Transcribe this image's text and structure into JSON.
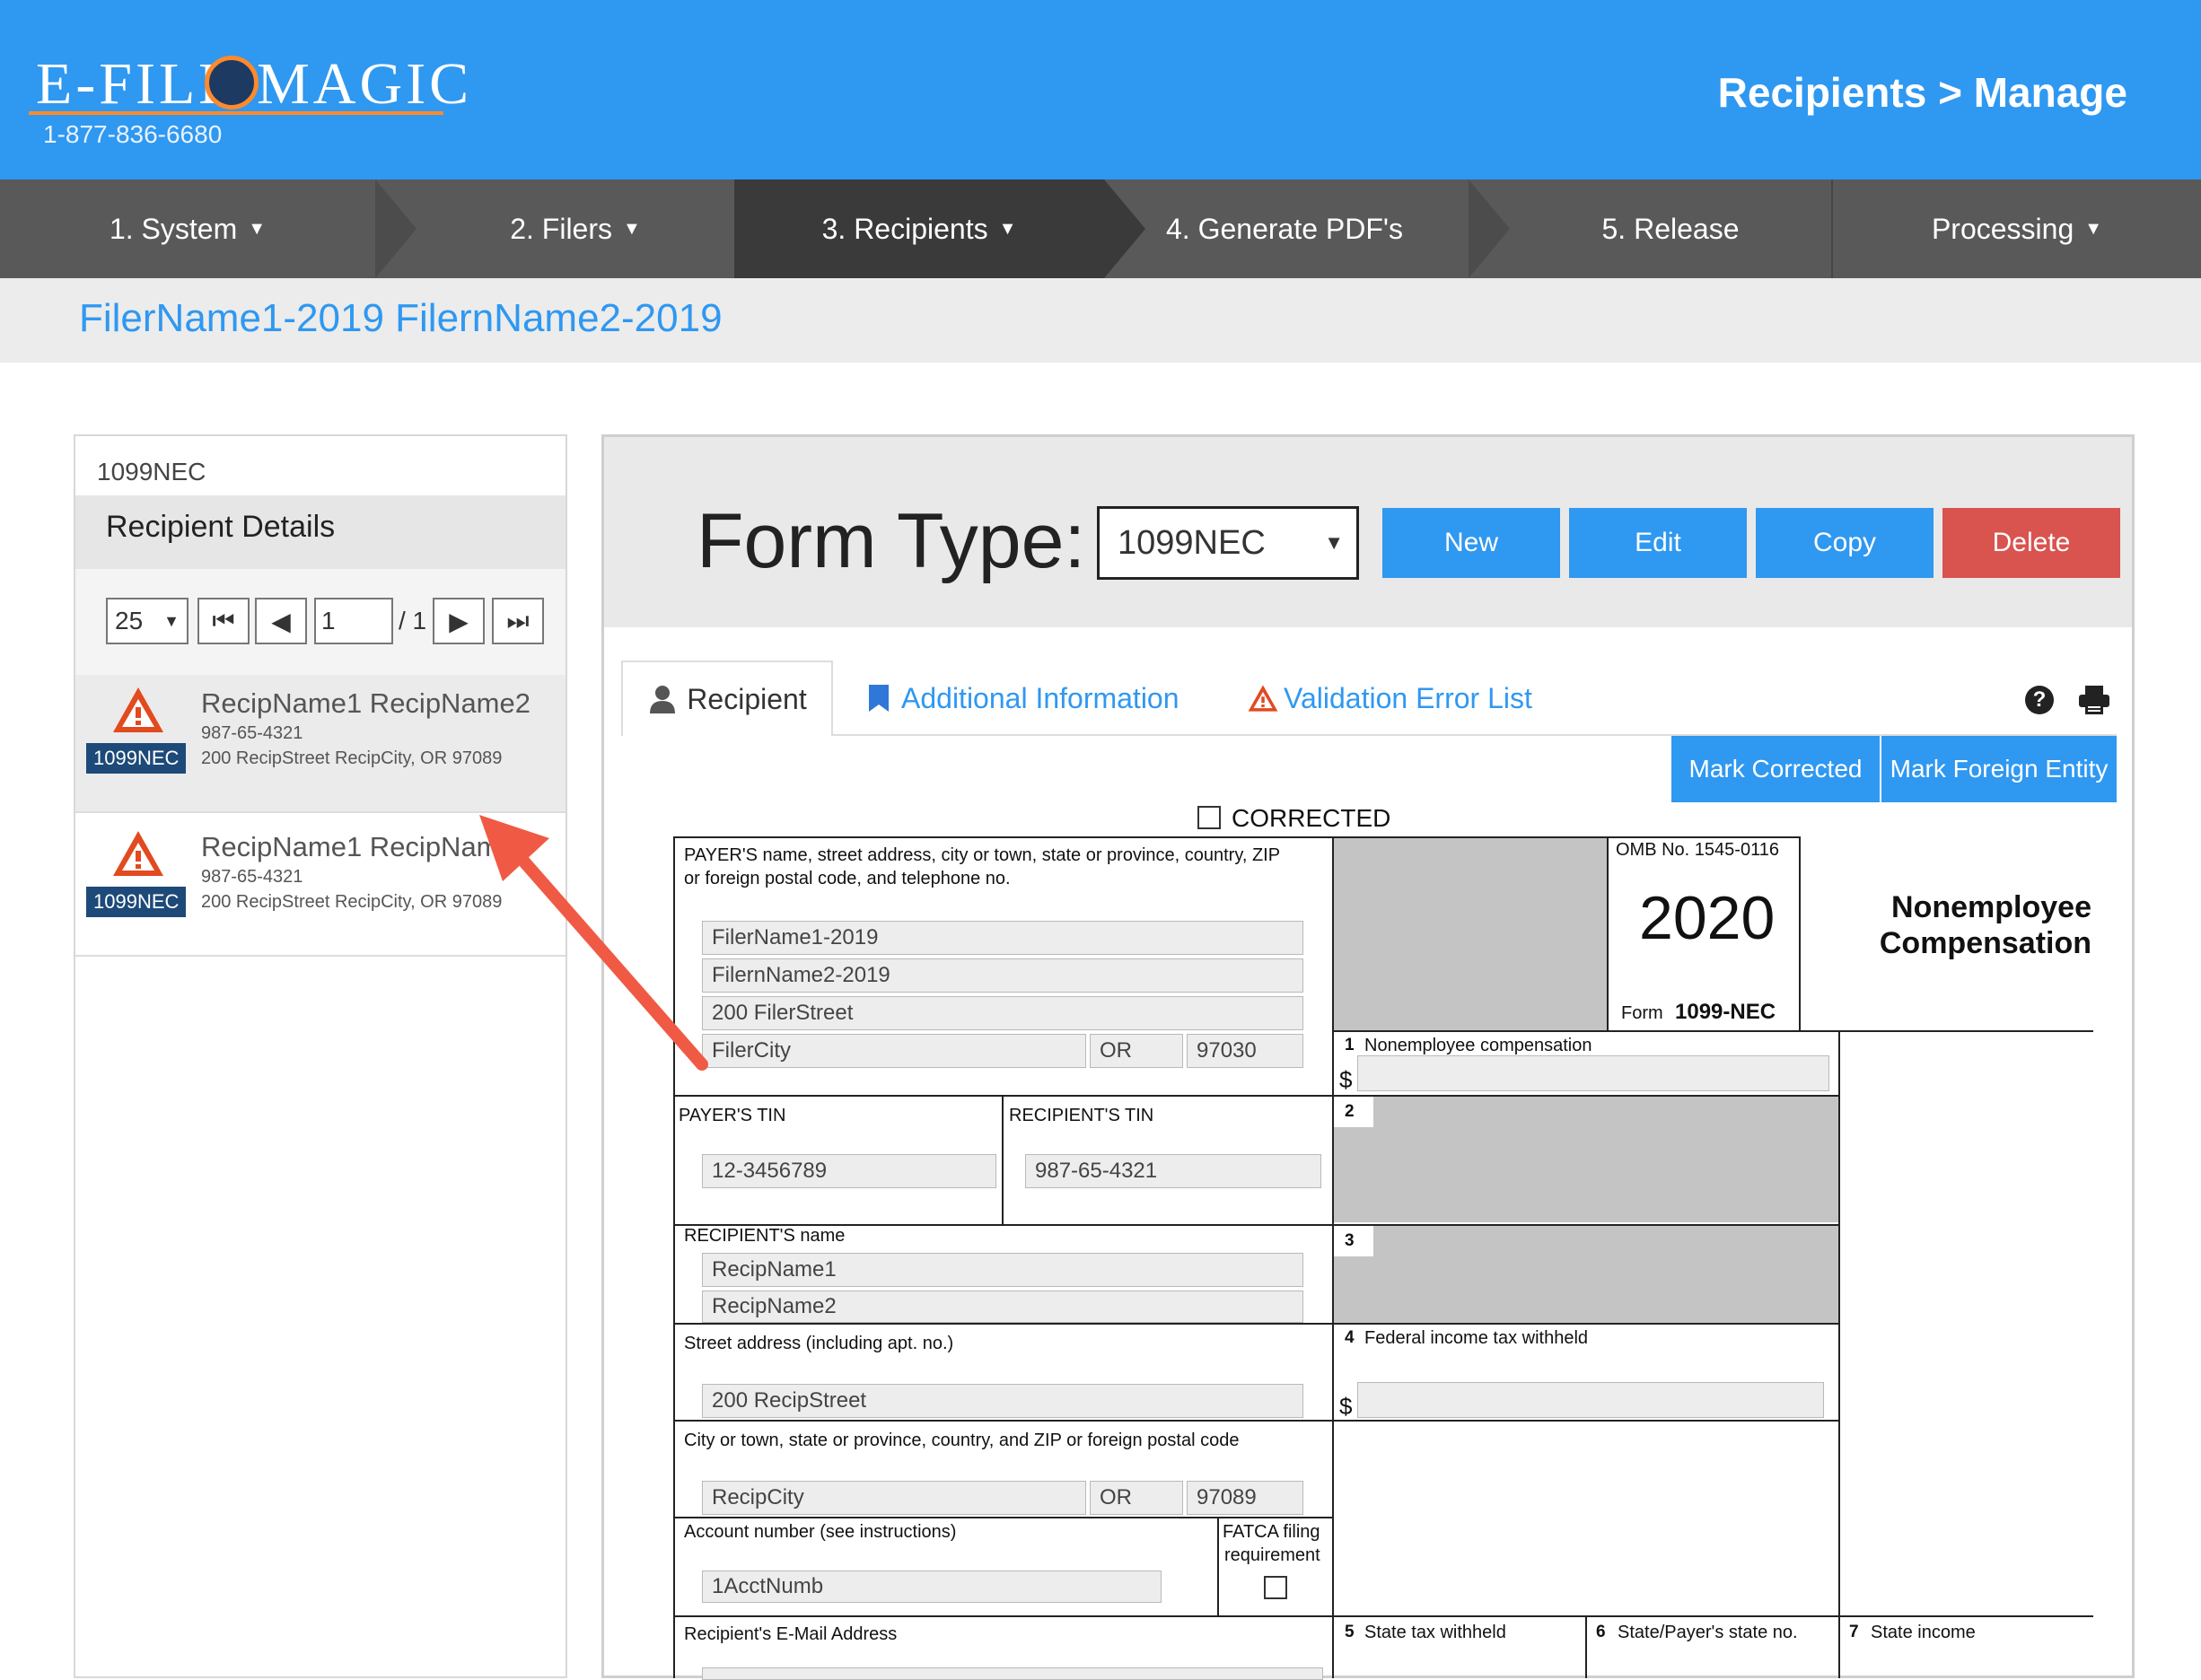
{
  "header": {
    "logo": "E-FILE MAGIC",
    "phone": "1-877-836-6680",
    "page_title": "Recipients > Manage",
    "brand_color": "#2f98f1",
    "accent_color": "#ff8a2b"
  },
  "nav": {
    "items": [
      {
        "label": "1. System"
      },
      {
        "label": "2. Filers"
      },
      {
        "label": "3. Recipients"
      },
      {
        "label": "4. Generate PDF's"
      },
      {
        "label": "5. Release"
      },
      {
        "label": "Processing"
      }
    ],
    "active_index": 2
  },
  "filer_bar": {
    "name": "FilerName1-2019 FilernName2-2019"
  },
  "left_panel": {
    "form_type": "1099NEC",
    "title": "Recipient Details",
    "pager": {
      "page_size": "25",
      "page": "1",
      "total": "/ 1"
    },
    "recipients": [
      {
        "name": "RecipName1 RecipName2",
        "tin": "987-65-4321",
        "address": "200 RecipStreet RecipCity, OR 97089",
        "badge": "1099NEC"
      },
      {
        "name": "RecipName1 RecipNam",
        "tin": "987-65-4321",
        "address": "200 RecipStreet RecipCity, OR 97089",
        "badge": "1099NEC"
      }
    ]
  },
  "toolbar": {
    "form_type_label": "Form Type:",
    "form_type_value": "1099NEC",
    "new": "New",
    "edit": "Edit",
    "copy": "Copy",
    "delete": "Delete",
    "delete_color": "#d9534f"
  },
  "tabs": {
    "recipient": "Recipient",
    "additional": "Additional Information",
    "validation": "Validation Error List"
  },
  "buttons": {
    "mark_corrected": "Mark Corrected",
    "mark_foreign": "Mark Foreign Entity"
  },
  "form": {
    "corrected": "CORRECTED",
    "payer_label": "PAYER'S name, street address, city or town, state or province, country, ZIP",
    "payer_label2": "or foreign postal code, and telephone no.",
    "payer_line1": "FilerName1-2019",
    "payer_line2": "FilernName2-2019",
    "payer_street": "200 FilerStreet",
    "payer_city": "FilerCity",
    "payer_state": "OR",
    "payer_zip": "97030",
    "omb": "OMB No. 1545-0116",
    "year": "2020",
    "form_prefix": "Form",
    "form_name": "1099-NEC",
    "title_line1": "Nonemployee",
    "title_line2": "Compensation",
    "box1_num": "1",
    "box1_label": "Nonemployee compensation",
    "dollar": "$",
    "box2_num": "2",
    "box3_num": "3",
    "box4_num": "4",
    "box4_label": "Federal income tax withheld",
    "payer_tin_label": "PAYER'S TIN",
    "payer_tin": "12-3456789",
    "recipient_tin_label": "RECIPIENT'S TIN",
    "recipient_tin": "987-65-4321",
    "recipient_name_label": "RECIPIENT'S name",
    "recipient_name1": "RecipName1",
    "recipient_name2": "RecipName2",
    "street_label": "Street address (including apt. no.)",
    "street": "200 RecipStreet",
    "city_label": "City or town, state or province, country, and ZIP or foreign postal code",
    "city": "RecipCity",
    "state": "OR",
    "zip": "97089",
    "account_label": "Account number (see instructions)",
    "account": "1AcctNumb",
    "fatca_label1": "FATCA filing",
    "fatca_label2": "requirement",
    "email_label": "Recipient's E-Mail Address",
    "box5_num": "5",
    "box5_label": "State tax withheld",
    "box6_num": "6",
    "box6_label": "State/Payer's state no.",
    "box7_num": "7",
    "box7_label": "State income"
  },
  "annotation": {
    "arrow_color": "#f05a44"
  }
}
